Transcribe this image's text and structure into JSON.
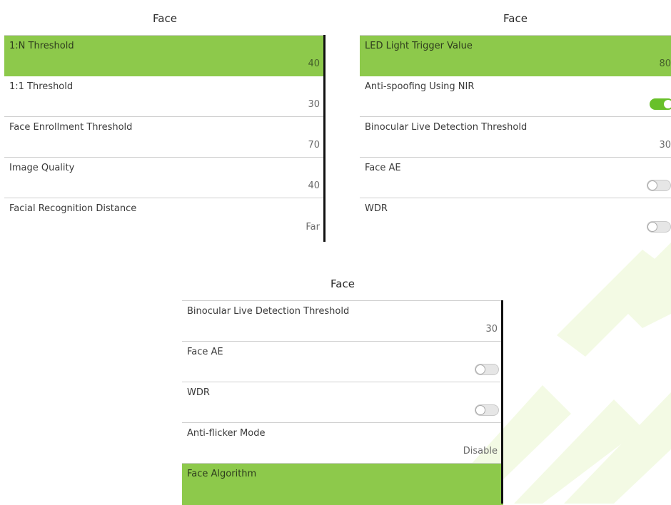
{
  "accent_color": "#8dc94b",
  "panel_left": {
    "title": "Face",
    "rows": [
      {
        "label": "1:N Threshold",
        "value": "40",
        "selected": true
      },
      {
        "label": "1:1 Threshold",
        "value": "30"
      },
      {
        "label": "Face Enrollment Threshold",
        "value": "70"
      },
      {
        "label": "Image Quality",
        "value": "40"
      },
      {
        "label": "Facial Recognition Distance",
        "value": "Far"
      }
    ]
  },
  "panel_right": {
    "title": "Face",
    "rows": [
      {
        "label": "LED Light Trigger Value",
        "value": "80",
        "selected": true
      },
      {
        "label": "Anti-spoofing Using NIR",
        "toggle": "on",
        "toggle_icon": "toggle-on-icon"
      },
      {
        "label": "Binocular Live Detection Threshold",
        "value": "30"
      },
      {
        "label": "Face AE",
        "toggle": "off",
        "toggle_icon": "toggle-off-icon"
      },
      {
        "label": "WDR",
        "toggle": "off",
        "toggle_icon": "toggle-off-icon"
      }
    ]
  },
  "panel_bottom": {
    "title": "Face",
    "rows": [
      {
        "label": "Binocular Live Detection Threshold",
        "value": "30"
      },
      {
        "label": "Face AE",
        "toggle": "off",
        "toggle_icon": "toggle-off-icon"
      },
      {
        "label": "WDR",
        "toggle": "off",
        "toggle_icon": "toggle-off-icon"
      },
      {
        "label": "Anti-flicker Mode",
        "value": "Disable"
      },
      {
        "label": "Face Algorithm",
        "value": "",
        "selected": true
      }
    ]
  }
}
